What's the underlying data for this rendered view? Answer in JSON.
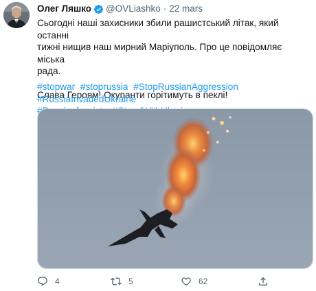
{
  "author": {
    "name": "Олег Ляшко",
    "handle": "@OVLiashko",
    "separator": "·",
    "date": "22 mars"
  },
  "tweet": {
    "line1": "Сьогодні наші захисники збили рашистський літак, який останні",
    "line2": "тижні нищив наш мирний Маріуполь. Про це повідомляє міська",
    "line3": "рада.",
    "line4": "Слава Героям! Окупанти горітимуть в пеклі!"
  },
  "hashtags": {
    "row1": [
      "#stopwar",
      "#stoprussia",
      "#StopRussianAggression",
      "#RussiaInvadedUkraine"
    ],
    "row2": [
      "#Russianfascists",
      "#StandWithUkraine"
    ]
  },
  "actions": {
    "reply_count": "4",
    "retweet_count": "5",
    "like_count": "62"
  },
  "icons": {
    "verified": "verified-badge-icon",
    "reply": "reply-icon",
    "retweet": "retweet-icon",
    "like": "heart-icon",
    "share": "share-icon"
  },
  "colors": {
    "link": "#1d9bf0",
    "secondary_text": "#536471",
    "primary_text": "#0f1419"
  }
}
